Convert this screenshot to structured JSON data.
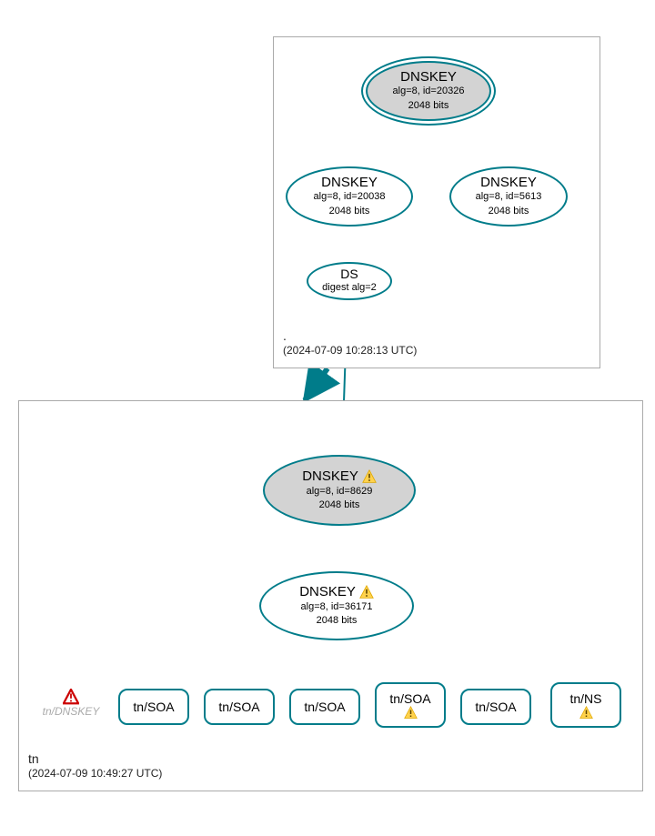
{
  "zones": {
    "root": {
      "name": ".",
      "timestamp": "(2024-07-09 10:28:13 UTC)"
    },
    "tn": {
      "name": "tn",
      "timestamp": "(2024-07-09 10:49:27 UTC)"
    }
  },
  "nodes": {
    "root_ksk": {
      "title": "DNSKEY",
      "line2": "alg=8, id=20326",
      "line3": "2048 bits"
    },
    "root_zsk1": {
      "title": "DNSKEY",
      "line2": "alg=8, id=20038",
      "line3": "2048 bits"
    },
    "root_zsk2": {
      "title": "DNSKEY",
      "line2": "alg=8, id=5613",
      "line3": "2048 bits"
    },
    "root_ds": {
      "title": "DS",
      "line2": "digest alg=2"
    },
    "tn_ksk": {
      "title": "DNSKEY",
      "line2": "alg=8, id=8629",
      "line3": "2048 bits"
    },
    "tn_zsk": {
      "title": "DNSKEY",
      "line2": "alg=8, id=36171",
      "line3": "2048 bits"
    },
    "error_node": {
      "label": "tn/DNSKEY"
    }
  },
  "leaves": {
    "l1": "tn/SOA",
    "l2": "tn/SOA",
    "l3": "tn/SOA",
    "l4": "tn/SOA",
    "l5": "tn/SOA",
    "l6": "tn/NS"
  },
  "chart_data": {
    "type": "diagram",
    "description": "DNSSEC authentication graph (DNSViz style)",
    "zones": [
      {
        "name": ".",
        "timestamp": "2024-07-09 10:28:13 UTC",
        "keys": [
          {
            "type": "DNSKEY",
            "role": "KSK",
            "alg": 8,
            "id": 20326,
            "bits": 2048,
            "self_signed": true
          },
          {
            "type": "DNSKEY",
            "role": "ZSK",
            "alg": 8,
            "id": 20038,
            "bits": 2048
          },
          {
            "type": "DNSKEY",
            "role": "ZSK",
            "alg": 8,
            "id": 5613,
            "bits": 2048
          }
        ],
        "ds": [
          {
            "digest_alg": 2
          }
        ]
      },
      {
        "name": "tn",
        "timestamp": "2024-07-09 10:49:27 UTC",
        "keys": [
          {
            "type": "DNSKEY",
            "role": "KSK",
            "alg": 8,
            "id": 8629,
            "bits": 2048,
            "self_signed": true,
            "warning": true
          },
          {
            "type": "DNSKEY",
            "role": "ZSK",
            "alg": 8,
            "id": 36171,
            "bits": 2048,
            "self_signed": true,
            "warning": true
          }
        ],
        "rrsets": [
          {
            "name": "tn/SOA"
          },
          {
            "name": "tn/SOA"
          },
          {
            "name": "tn/SOA"
          },
          {
            "name": "tn/SOA",
            "warning": true
          },
          {
            "name": "tn/SOA"
          },
          {
            "name": "tn/NS",
            "warning": true
          }
        ],
        "errors": [
          {
            "label": "tn/DNSKEY"
          }
        ]
      }
    ],
    "edges": [
      {
        "from": "root KSK 20326",
        "to": "root KSK 20326",
        "kind": "self-loop"
      },
      {
        "from": "root KSK 20326",
        "to": "root ZSK 20038"
      },
      {
        "from": "root KSK 20326",
        "to": "root ZSK 5613"
      },
      {
        "from": "root ZSK 20038",
        "to": "root DS digest alg=2"
      },
      {
        "from": "root DS digest alg=2",
        "to": "tn KSK 8629"
      },
      {
        "from": "root zone",
        "to": "tn zone",
        "kind": "delegation",
        "style": "thick"
      },
      {
        "from": "tn KSK 8629",
        "to": "tn KSK 8629",
        "kind": "self-loop"
      },
      {
        "from": "tn KSK 8629",
        "to": "tn ZSK 36171"
      },
      {
        "from": "tn ZSK 36171",
        "to": "tn ZSK 36171",
        "kind": "self-loop"
      },
      {
        "from": "tn ZSK 36171",
        "to": "tn/SOA",
        "count": 5
      },
      {
        "from": "tn ZSK 36171",
        "to": "tn/NS"
      }
    ]
  }
}
